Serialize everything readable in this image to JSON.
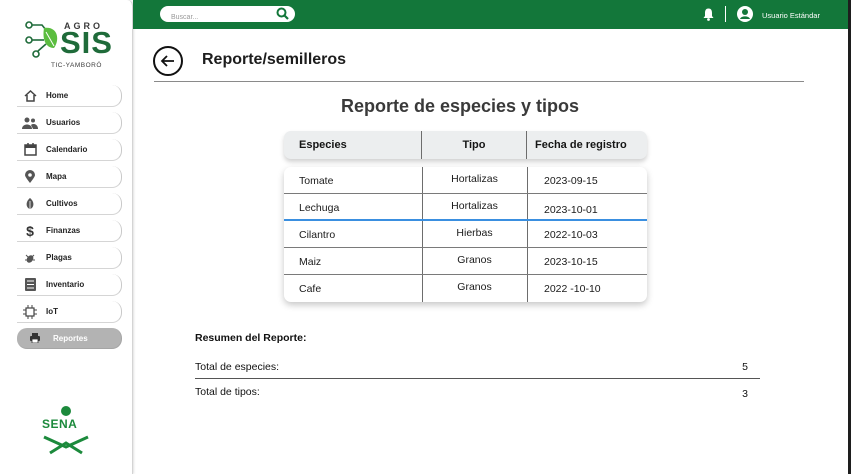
{
  "brand": {
    "agro": "AGRO",
    "sis": "SIS",
    "tagline": "TIC-YAMBORÓ",
    "sena": "SENA"
  },
  "topbar": {
    "search_placeholder": "Buscar...",
    "user_name": "Usuario Estándar"
  },
  "sidebar": {
    "items": [
      {
        "label": "Home",
        "icon": "home-icon"
      },
      {
        "label": "Usuarios",
        "icon": "users-icon"
      },
      {
        "label": "Calendario",
        "icon": "calendar-icon"
      },
      {
        "label": "Mapa",
        "icon": "map-pin-icon"
      },
      {
        "label": "Cultivos",
        "icon": "leaf-icon"
      },
      {
        "label": "Finanzas",
        "icon": "dollar-icon"
      },
      {
        "label": "Plagas",
        "icon": "bug-icon"
      },
      {
        "label": "Inventario",
        "icon": "inventory-icon"
      },
      {
        "label": "IoT",
        "icon": "chip-icon"
      },
      {
        "label": "Reportes",
        "icon": "printer-icon",
        "active": true
      }
    ]
  },
  "page": {
    "title": "Reporte/semilleros",
    "report_title": "Reporte de especies y tipos"
  },
  "table": {
    "headers": [
      "Especies",
      "Tipo",
      "Fecha de registro"
    ],
    "rows": [
      [
        "Tomate",
        "Hortalizas",
        "2023-09-15"
      ],
      [
        "Lechuga",
        "Hortalizas",
        "2023-10-01"
      ],
      [
        "Cilantro",
        "Hierbas",
        "2022-10-03"
      ],
      [
        "Maiz",
        "Granos",
        "2023-10-15"
      ],
      [
        "Cafe",
        "Granos",
        "2022 -10-10"
      ]
    ]
  },
  "summary": {
    "title": "Resumen del Reporte:",
    "total_species_label": "Total de especies:",
    "total_species_value": "5",
    "total_types_label": "Total de tipos:",
    "total_types_value": "3"
  },
  "colors": {
    "brand_green": "#13773a",
    "active_nav": "#b3b3b3",
    "selection": "#3a8fe0"
  }
}
